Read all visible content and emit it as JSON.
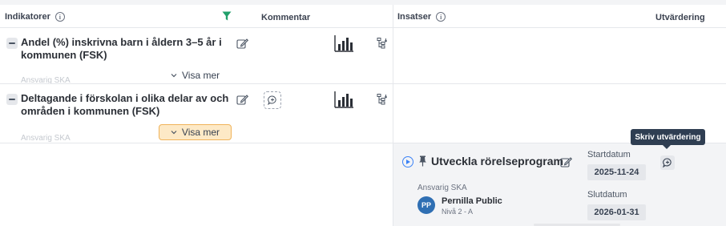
{
  "left": {
    "header": {
      "indikatorer": "Indikatorer",
      "kommentar": "Kommentar"
    },
    "rows": [
      {
        "title": "Andel (%) inskrivna barn i åldern 3–5 år i kommunen (FSK)",
        "faded": "Ansvarig SKA",
        "visa_label": "Visa mer"
      },
      {
        "title": "Deltagande i förskolan i olika delar av och områden i kommunen (FSK)",
        "faded": "Ansvarig SKA",
        "visa_label": "Visa mer"
      }
    ]
  },
  "right": {
    "header": {
      "insatser": "Insatser",
      "utvardering": "Utvärdering"
    },
    "card": {
      "title": "Utveckla rörelseprogram",
      "responsible_label": "Ansvarig SKA",
      "avatar_initials": "PP",
      "person_name": "Pernilla Public",
      "person_level": "Nivå 2 - A",
      "start_label": "Startdatum",
      "start_value": "2025-11-24",
      "end_label": "Slutdatum",
      "end_value": "2026-01-31"
    },
    "tooltip": "Skriv utvärdering"
  },
  "icons": {
    "info": "i",
    "filter": "filter-icon",
    "edit": "edit-icon",
    "chart": "bar-chart-icon",
    "tree": "hierarchy-icon",
    "comment": "comment-add-icon",
    "play": "play-circle-icon",
    "pin": "pin-icon"
  },
  "colors": {
    "filter_green": "#22a06b",
    "visa_highlight_bg": "#fde9c6",
    "visa_highlight_border": "#f0b35a",
    "tooltip_bg": "#2f3e52",
    "avatar_bg": "#2f6fb3",
    "play_blue": "#3b82f6"
  }
}
